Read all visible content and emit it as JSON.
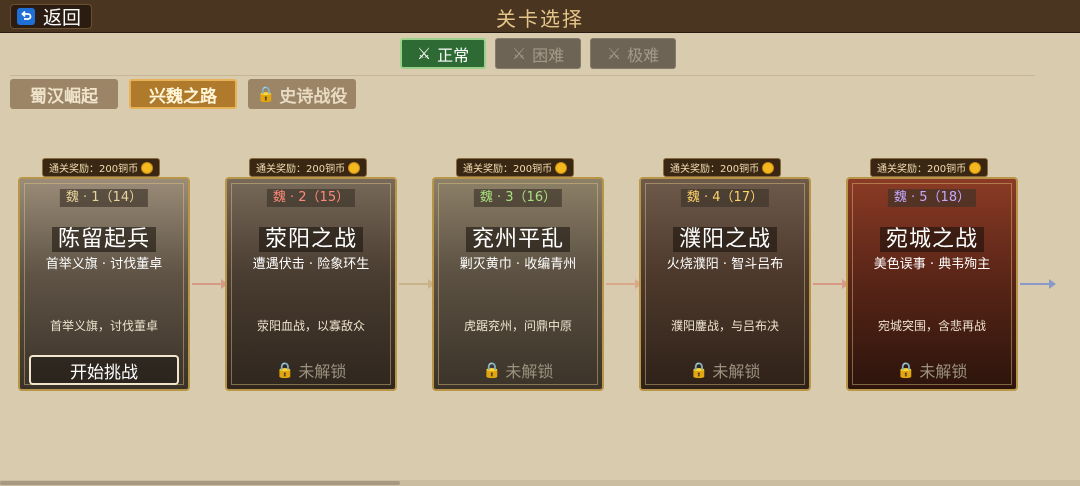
{
  "header": {
    "back_label": "返回",
    "title": "关卡选择"
  },
  "difficulty": [
    {
      "label": "正常",
      "state": "active"
    },
    {
      "label": "困难",
      "state": "disabled"
    },
    {
      "label": "极难",
      "state": "disabled"
    }
  ],
  "categories": [
    {
      "label": "蜀汉崛起",
      "state": "inactive"
    },
    {
      "label": "兴魏之路",
      "state": "active"
    },
    {
      "label": "史诗战役",
      "state": "locked"
    }
  ],
  "levels": [
    {
      "reward": "通关奖励：200铜币",
      "tag": "魏 · 1（14）",
      "title": "陈留起兵",
      "subtitle": "首举义旗 · 讨伐董卓",
      "desc": "首举义旗，讨伐董卓",
      "action": "开始挑战"
    },
    {
      "reward": "通关奖励：200铜币",
      "tag": "魏 · 2（15）",
      "title": "荥阳之战",
      "subtitle": "遭遇伏击 · 险象环生",
      "desc": "荥阳血战，以寡敌众",
      "action": "未解锁"
    },
    {
      "reward": "通关奖励：200铜币",
      "tag": "魏 · 3（16）",
      "title": "兖州平乱",
      "subtitle": "剿灭黄巾 · 收编青州",
      "desc": "虎踞兖州，问鼎中原",
      "action": "未解锁"
    },
    {
      "reward": "通关奖励：200铜币",
      "tag": "魏 · 4（17）",
      "title": "濮阳之战",
      "subtitle": "火烧濮阳 · 智斗吕布",
      "desc": "濮阳鏖战，与吕布决",
      "action": "未解锁"
    },
    {
      "reward": "通关奖励：200铜币",
      "tag": "魏 · 5（18）",
      "title": "宛城之战",
      "subtitle": "美色误事 · 典韦殉主",
      "desc": "宛城突围，含悲再战",
      "action": "未解锁"
    }
  ]
}
